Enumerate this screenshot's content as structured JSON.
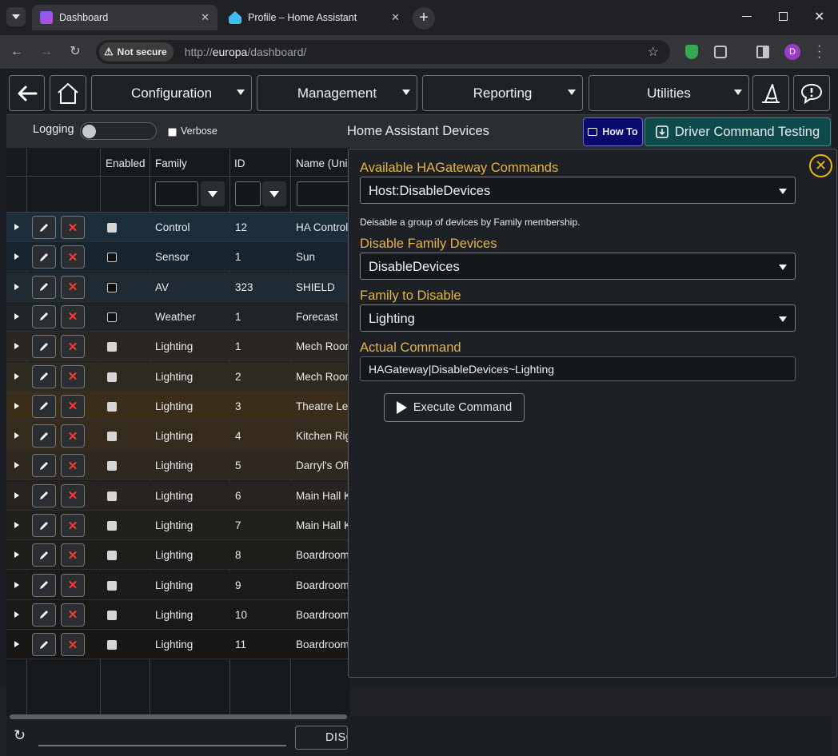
{
  "browser": {
    "tabs": [
      {
        "title": "Dashboard",
        "active": true
      },
      {
        "title": "Profile – Home Assistant",
        "active": false
      }
    ],
    "security_label": "Not secure",
    "url_prefix": "http://",
    "url_host": "europa",
    "url_path": "/dashboard/",
    "profile_initial": "D"
  },
  "nav": {
    "menus": [
      "Configuration",
      "Management",
      "Reporting",
      "Utilities"
    ]
  },
  "subbar": {
    "logging_label": "Logging",
    "verbose_label": "Verbose",
    "title": "Home Assistant Devices",
    "howto_label": "How To",
    "driver_label": "Driver Command Testing"
  },
  "grid": {
    "headers": [
      "Enabled",
      "Family",
      "ID",
      "Name (Unic"
    ],
    "rows": [
      {
        "enabled": true,
        "family": "Control",
        "id": "12",
        "name": "HA Control"
      },
      {
        "enabled": false,
        "family": "Sensor",
        "id": "1",
        "name": "Sun"
      },
      {
        "enabled": false,
        "family": "AV",
        "id": "323",
        "name": "SHIELD"
      },
      {
        "enabled": false,
        "family": "Weather",
        "id": "1",
        "name": "Forecast"
      },
      {
        "enabled": true,
        "family": "Lighting",
        "id": "1",
        "name": "Mech Room"
      },
      {
        "enabled": true,
        "family": "Lighting",
        "id": "2",
        "name": "Mech Room"
      },
      {
        "enabled": true,
        "family": "Lighting",
        "id": "3",
        "name": "Theatre Left"
      },
      {
        "enabled": true,
        "family": "Lighting",
        "id": "4",
        "name": "Kitchen Right"
      },
      {
        "enabled": true,
        "family": "Lighting",
        "id": "5",
        "name": "Darryl's Office"
      },
      {
        "enabled": true,
        "family": "Lighting",
        "id": "6",
        "name": "Main Hall K"
      },
      {
        "enabled": true,
        "family": "Lighting",
        "id": "7",
        "name": "Main Hall K"
      },
      {
        "enabled": true,
        "family": "Lighting",
        "id": "8",
        "name": "Boardroom"
      },
      {
        "enabled": true,
        "family": "Lighting",
        "id": "9",
        "name": "Boardroom"
      },
      {
        "enabled": true,
        "family": "Lighting",
        "id": "10",
        "name": "Boardroom"
      },
      {
        "enabled": true,
        "family": "Lighting",
        "id": "11",
        "name": "Boardroom"
      }
    ]
  },
  "panel": {
    "commands_label": "Available HAGateway Commands",
    "command_value": "Host:DisableDevices",
    "description": "Deisable a group of devices by Family membership.",
    "disable_label": "Disable Family Devices",
    "disable_value": "DisableDevices",
    "family_label": "Family to Disable",
    "family_value": "Lighting",
    "actual_label": "Actual Command",
    "actual_value": "HAGateway|DisableDevices~Lighting",
    "execute_label": "Execute Command"
  },
  "footer": {
    "disconnect_label": "DISC"
  },
  "colors": {
    "accent_label": "#e8b446",
    "howto_bg": "#0a0a6e",
    "driver_bg": "#0f4a4a",
    "delete_red": "#ff3b30",
    "close_ring": "#f2b705"
  }
}
